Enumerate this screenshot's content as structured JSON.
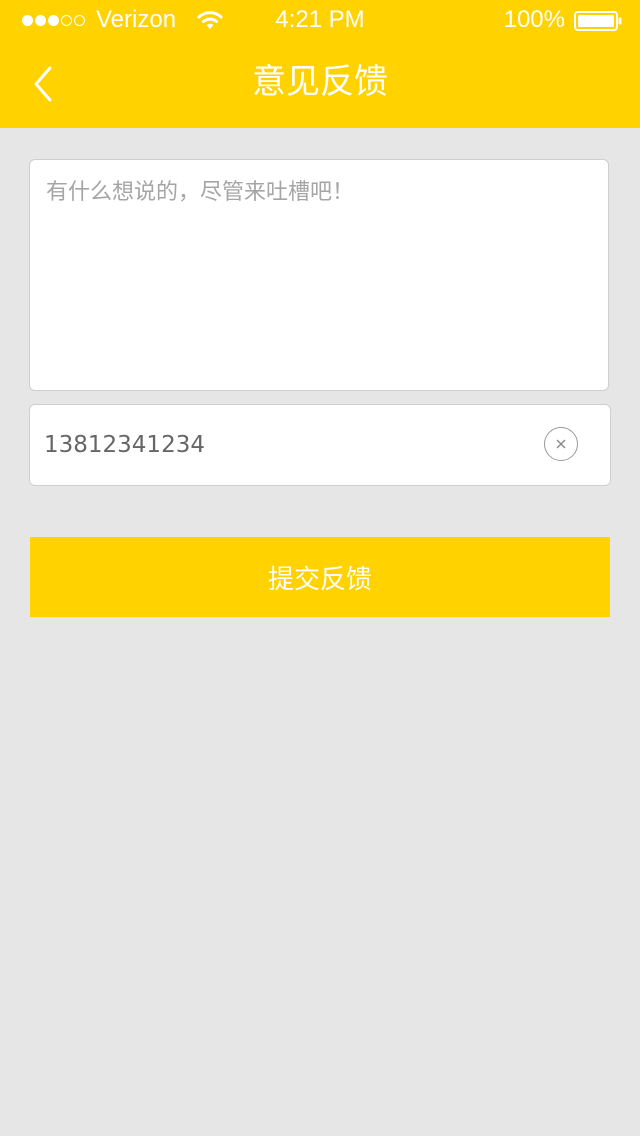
{
  "status_bar": {
    "carrier": "Verizon",
    "time": "4:21 PM",
    "battery": "100%",
    "signal_bars_filled": 3,
    "signal_bars_total": 5
  },
  "nav": {
    "title": "意见反馈",
    "back_icon": "chevron-left-icon"
  },
  "feedback": {
    "placeholder": "有什么想说的，尽管来吐槽吧！",
    "value": ""
  },
  "phone": {
    "value": "13812341234",
    "clear_icon": "clear-icon"
  },
  "submit": {
    "label": "提交反馈"
  },
  "colors": {
    "accent": "#ffd200",
    "background": "#e6e6e6",
    "field_border": "#cfcfcf"
  }
}
